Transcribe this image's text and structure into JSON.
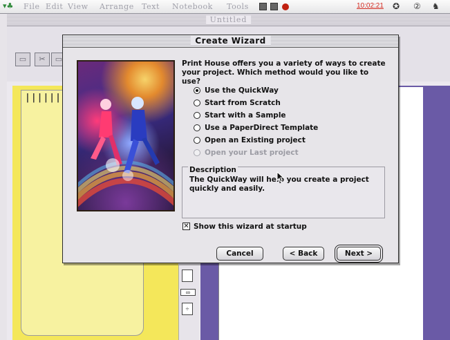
{
  "menubar": {
    "items": [
      "File",
      "Edit",
      "View",
      "Arrange",
      "Text",
      "Notebook",
      "Tools"
    ],
    "clock": "10:02:21",
    "icons": [
      "apple-menu-icon",
      "tool-icon-a",
      "tool-icon-b",
      "record-icon",
      "speaker-icon",
      "help-icon",
      "app-switch-icon"
    ]
  },
  "document": {
    "title": "Untitled",
    "notebook_rings": "||||||"
  },
  "dialog": {
    "title": "Create Wizard",
    "prompt": "Print House offers you a variety of ways to create your project. Which method would you like to use?",
    "options": [
      {
        "label": "Use the QuickWay",
        "selected": true,
        "enabled": true
      },
      {
        "label": "Start from Scratch",
        "selected": false,
        "enabled": true
      },
      {
        "label": "Start with a Sample",
        "selected": false,
        "enabled": true
      },
      {
        "label": "Use a PaperDirect Template",
        "selected": false,
        "enabled": true
      },
      {
        "label": "Open an Existing project",
        "selected": false,
        "enabled": true
      },
      {
        "label": "Open your Last project",
        "selected": false,
        "enabled": false
      }
    ],
    "description": {
      "heading": "Description",
      "text": "The QuickWay will help you create a project quickly and easily."
    },
    "startup_checkbox": {
      "label": "Show this wizard at startup",
      "checked": true,
      "mark": "✕"
    },
    "buttons": {
      "cancel": "Cancel",
      "back": "< Back",
      "next": "Next >"
    }
  },
  "colors": {
    "accent_clock": "#d42a20",
    "yellow_panel": "#f4e75a",
    "purple_band": "#6a5aa6"
  }
}
